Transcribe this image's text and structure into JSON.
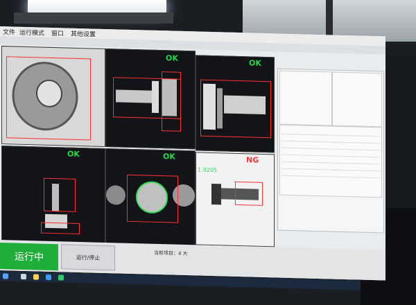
{
  "menu": [
    "文件",
    "运行模式",
    "窗口",
    "其他设置"
  ],
  "cameras": [
    {
      "status": ""
    },
    {
      "status": "OK"
    },
    {
      "status": "OK"
    },
    {
      "status": "OK"
    },
    {
      "status": "OK"
    },
    {
      "status": "NG",
      "measure": "1.9205"
    }
  ],
  "buttons": {
    "run": "运行中",
    "mode": "运行/停止"
  },
  "status_bar": {
    "current_item": "当前项目：4 大"
  },
  "colors": {
    "ok": "#22dd44",
    "ng": "#ff3b3b",
    "run_button": "#1fae3a",
    "box": "#ff3030"
  }
}
